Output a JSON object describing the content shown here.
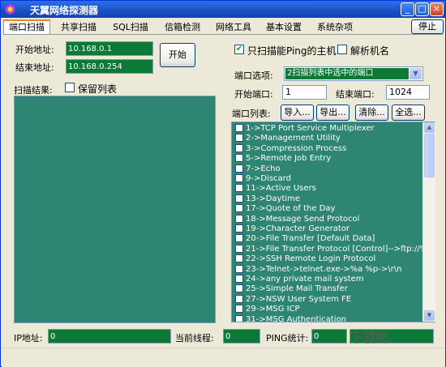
{
  "window": {
    "title": "天翼网络探测器",
    "minimize": "_",
    "maximize": "□",
    "close": "×"
  },
  "tabs": [
    "端口扫描",
    "共享扫描",
    "SQL扫描",
    "信箱检测",
    "网络工具",
    "基本设置",
    "系统杂项"
  ],
  "active_tab": 0,
  "stop_button": "停止",
  "scan": {
    "start_label": "开始地址:",
    "start_value": "10.168.0.1",
    "end_label": "结束地址:",
    "end_value": "10.168.0.254",
    "start_button": "开始",
    "results_label": "扫描结果:",
    "keep_list_label": "保留列表",
    "keep_list_checked": false
  },
  "options": {
    "ping_only_label": "只扫描能Ping的主机",
    "ping_only_checked": true,
    "resolve_label": "解析机名",
    "resolve_checked": false,
    "port_option_label": "端口选项:",
    "port_option_value": "2扫描列表中选中的端口",
    "start_port_label": "开始端口:",
    "start_port_value": "1",
    "end_port_label": "结束端口:",
    "end_port_value": "1024",
    "port_list_label": "端口列表:",
    "import_button": "导入...",
    "export_button": "导出...",
    "clear_button": "清除...",
    "select_all_button": "全选..."
  },
  "ports": [
    "1->TCP Port Service Multiplexer",
    "2->Management Utility",
    "3->Compression Process",
    "5->Remote Job Entry",
    "7->Echo",
    "9->Discard",
    "11->Active Users",
    "13->Daytime",
    "17->Quote of the Day",
    "18->Message Send Protocol",
    "19->Character Generator",
    "20->File Transfer [Default Data]",
    "21->File Transfer Protocol [Control]-->ftp://%a:%p",
    "22->SSH Remote Login Protocol",
    "23->Telnet->telnet.exe->%a %p->\\r\\n",
    "24->any private mail system",
    "25->Simple Mail Transfer",
    "27->NSW User System FE",
    "29->MSG ICP",
    "31->MSG Authentication"
  ],
  "status": {
    "ip_label": "IP地址:",
    "ip_value": "0",
    "threads_label": "当前线程:",
    "threads_value": "0",
    "ping_label": "PING统计:",
    "ping_value": "0"
  },
  "watermark": "下载吧"
}
